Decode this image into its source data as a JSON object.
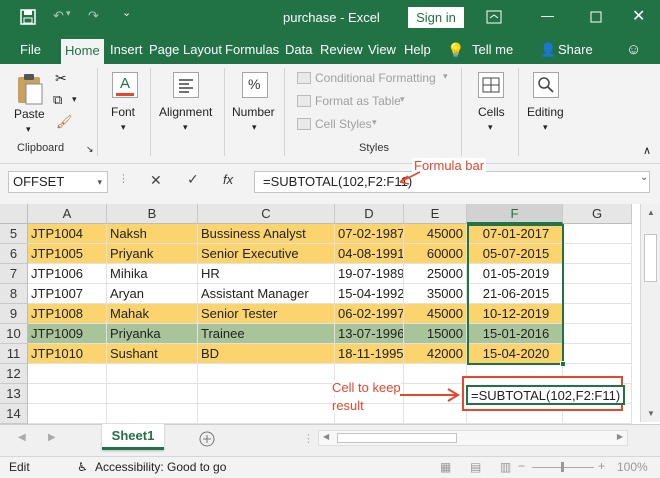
{
  "app": {
    "title": "purchase  -  Excel",
    "signin": "Sign in"
  },
  "tabs": [
    "File",
    "Home",
    "Insert",
    "Page Layout",
    "Formulas",
    "Data",
    "Review",
    "View",
    "Help",
    "Tell me",
    "Share"
  ],
  "ribbon": {
    "paste": "Paste",
    "clipboard": "Clipboard",
    "font": "Font",
    "alignment": "Alignment",
    "number": "Number",
    "conditional": "Conditional Formatting",
    "format_table": "Format as Table",
    "cell_styles": "Cell Styles",
    "styles": "Styles",
    "cells": "Cells",
    "editing": "Editing"
  },
  "formula_bar": {
    "name_box": "OFFSET",
    "fx": "fx",
    "formula": "=SUBTOTAL(102,F2:F11)",
    "annotation": "Formula bar"
  },
  "columns": [
    "A",
    "B",
    "C",
    "D",
    "E",
    "F",
    "G"
  ],
  "rows": [
    {
      "num": "5",
      "a": "JTP1004",
      "b": "Naksh",
      "c": "Bussiness Analyst",
      "d": "07-02-1987",
      "e": "45000",
      "f": "07-01-2017",
      "fill": "#fbd46e"
    },
    {
      "num": "6",
      "a": "JTP1005",
      "b": "Priyank",
      "c": "Senior Executive",
      "d": "04-08-1991",
      "e": "60000",
      "f": "05-07-2015",
      "fill": "#fbd46e"
    },
    {
      "num": "7",
      "a": "JTP1006",
      "b": "Mihika",
      "c": "HR",
      "d": "19-07-1989",
      "e": "25000",
      "f": "01-05-2019",
      "fill": "#ffffff"
    },
    {
      "num": "8",
      "a": "JTP1007",
      "b": "Aryan",
      "c": "Assistant Manager",
      "d": "15-04-1992",
      "e": "35000",
      "f": "21-06-2015",
      "fill": "#ffffff"
    },
    {
      "num": "9",
      "a": "JTP1008",
      "b": "Mahak",
      "c": "Senior Tester",
      "d": "06-02-1997",
      "e": "45000",
      "f": "10-12-2019",
      "fill": "#fbd46e"
    },
    {
      "num": "10",
      "a": "JTP1009",
      "b": "Priyanka",
      "c": "Trainee",
      "d": "13-07-1996",
      "e": "15000",
      "f": "15-01-2016",
      "fill": "#a9c49a"
    },
    {
      "num": "11",
      "a": "JTP1010",
      "b": "Sushant",
      "c": "BD",
      "d": "18-11-1995",
      "e": "42000",
      "f": "15-04-2020",
      "fill": "#fbd46e"
    },
    {
      "num": "12",
      "a": "",
      "b": "",
      "c": "",
      "d": "",
      "e": "",
      "f": "",
      "fill": "#ffffff"
    },
    {
      "num": "13",
      "a": "",
      "b": "",
      "c": "",
      "d": "",
      "e": "",
      "f": "",
      "fill": "#ffffff"
    },
    {
      "num": "14",
      "a": "",
      "b": "",
      "c": "",
      "d": "",
      "e": "",
      "f": "",
      "fill": "#ffffff"
    }
  ],
  "result_cell": {
    "text": "=SUBTOTAL(102,F2:F11)",
    "annotation_line1": "Cell to keep",
    "annotation_line2": "result"
  },
  "sheet_tab": "Sheet1",
  "status": {
    "mode": "Edit",
    "accessibility": "Accessibility: Good to go",
    "zoom": "100%"
  },
  "colors": {
    "excel_green": "#217346",
    "annotation_red": "#e8452b",
    "yellow": "#fbd46e",
    "green_row": "#a9c49a"
  }
}
